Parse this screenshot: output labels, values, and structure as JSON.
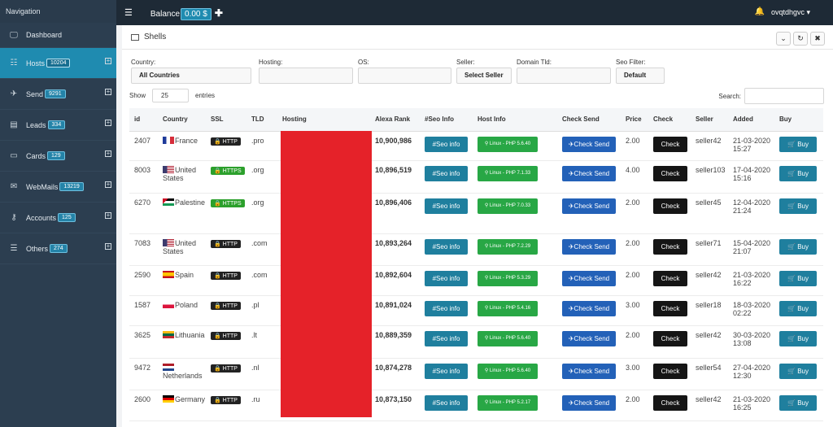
{
  "sidebar": {
    "title": "Navigation",
    "items": [
      {
        "label": "Dashboard",
        "badge": "",
        "icon": "monitor-icon"
      },
      {
        "label": "Hosts",
        "badge": "10204",
        "icon": "list-icon"
      },
      {
        "label": "Send",
        "badge": "9291",
        "icon": "send-icon"
      },
      {
        "label": "Leads",
        "badge": "334",
        "icon": "leads-icon"
      },
      {
        "label": "Cards",
        "badge": "129",
        "icon": "card-icon"
      },
      {
        "label": "WebMails",
        "badge": "13219",
        "icon": "mail-icon"
      },
      {
        "label": "Accounts",
        "badge": "125",
        "icon": "key-icon"
      },
      {
        "label": "Others",
        "badge": "274",
        "icon": "menu-icon"
      }
    ]
  },
  "topbar": {
    "balance_label": "Balance",
    "balance_value": "0.00 $",
    "username": "ovqtdhgvc"
  },
  "panel": {
    "title": "Shells"
  },
  "filters": {
    "country": {
      "label": "Country:",
      "value": "All Countries"
    },
    "hosting": {
      "label": "Hosting:",
      "value": ""
    },
    "os": {
      "label": "OS:",
      "value": ""
    },
    "seller": {
      "label": "Seller:",
      "value": "Select Seller"
    },
    "domain_tld": {
      "label": "Domain Tld:",
      "value": ""
    },
    "seo": {
      "label": "Seo Filter:",
      "value": "Default"
    }
  },
  "entries": {
    "show": "Show",
    "value": "25",
    "suffix": "entries",
    "search": "Search:"
  },
  "table": {
    "headers": [
      "id",
      "Country",
      "SSL",
      "TLD",
      "Hosting",
      "Alexa Rank",
      "#Seo Info",
      "Host Info",
      "Check Send",
      "Price",
      "Check",
      "Seller",
      "Added",
      "Buy"
    ],
    "rows": [
      {
        "id": "2407",
        "country": "France",
        "ssl": "HTTP",
        "tld": ".pro",
        "rank": "10,900,986",
        "host": "Linux - PHP 5.6.40",
        "price": "2.00",
        "seller": "seller42",
        "added1": "21-03-2020",
        "added2": "15:27"
      },
      {
        "id": "8003",
        "country": "United States",
        "ssl": "HTTPS",
        "tld": ".org",
        "rank": "10,896,519",
        "host": "Linux - PHP 7.1.33",
        "price": "4.00",
        "seller": "seller103",
        "added1": "17-04-2020",
        "added2": "15:16"
      },
      {
        "id": "6270",
        "country": "Palestine",
        "ssl": "HTTPS",
        "tld": ".org",
        "rank": "10,896,406",
        "host": "Linux - PHP 7.0.33",
        "price": "2.00",
        "seller": "seller45",
        "added1": "12-04-2020",
        "added2": "21:24"
      },
      {
        "id": "7083",
        "country": "United States",
        "ssl": "HTTP",
        "tld": ".com",
        "rank": "10,893,264",
        "host": "Linux - PHP 7.2.29",
        "price": "2.00",
        "seller": "seller71",
        "added1": "15-04-2020",
        "added2": "21:07"
      },
      {
        "id": "2590",
        "country": "Spain",
        "ssl": "HTTP",
        "tld": ".com",
        "rank": "10,892,604",
        "host": "Linux - PHP 5.3.29",
        "price": "2.00",
        "seller": "seller42",
        "added1": "21-03-2020",
        "added2": "16:22"
      },
      {
        "id": "1587",
        "country": "Poland",
        "ssl": "HTTP",
        "tld": ".pl",
        "rank": "10,891,024",
        "host": "Linux - PHP 5.4.16",
        "price": "3.00",
        "seller": "seller18",
        "added1": "18-03-2020",
        "added2": "02:22"
      },
      {
        "id": "3625",
        "country": "Lithuania",
        "ssl": "HTTP",
        "tld": ".lt",
        "rank": "10,889,359",
        "host": "Linux - PHP 5.6.40",
        "price": "2.00",
        "seller": "seller42",
        "added1": "30-03-2020",
        "added2": "13:08"
      },
      {
        "id": "9472",
        "country": "Netherlands",
        "ssl": "HTTP",
        "tld": ".nl",
        "rank": "10,874,278",
        "host": "Linux - PHP 5.6.40",
        "price": "3.00",
        "seller": "seller54",
        "added1": "27-04-2020",
        "added2": "12:30"
      },
      {
        "id": "2600",
        "country": "Germany",
        "ssl": "HTTP",
        "tld": ".ru",
        "rank": "10,873,150",
        "host": "Linux - PHP 5.2.17",
        "price": "2.00",
        "seller": "seller42",
        "added1": "21-03-2020",
        "added2": "16:25"
      }
    ],
    "seo_label": "#Seo info",
    "send_label": "Check Send",
    "check_label": "Check",
    "buy_label": "Buy"
  },
  "colors": {
    "sidebar": "#2c3e50",
    "active": "#1f8bb0",
    "hosting_mask": "#e52229"
  }
}
